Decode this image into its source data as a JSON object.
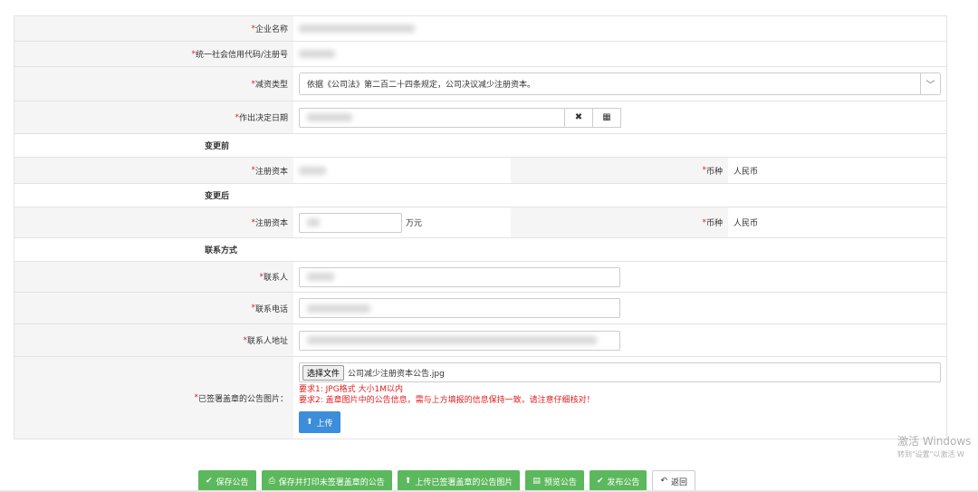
{
  "form": {
    "company_name_label": "企业名称",
    "company_name_value": "",
    "credit_code_label": "统一社会信用代码/注册号",
    "credit_code_value": "",
    "reduction_type_label": "减资类型",
    "reduction_type_value": "依据《公司法》第二百二十四条规定，公司决议减少注册资本。",
    "decision_date_label": "作出决定日期",
    "decision_date_value": "",
    "before_title": "变更前",
    "before_capital_label": "注册资本",
    "before_capital_value": "",
    "before_currency_label": "币种",
    "before_currency_value": "人民币",
    "after_title": "变更后",
    "after_capital_label": "注册资本",
    "after_capital_value": "",
    "after_capital_unit": "万元",
    "after_currency_label": "币种",
    "after_currency_value": "人民币",
    "contact_title": "联系方式",
    "contact_person_label": "联系人",
    "contact_person_value": "",
    "contact_phone_label": "联系电话",
    "contact_phone_value": "",
    "contact_address_label": "联系人地址",
    "contact_address_value": "",
    "notice_image_label": "已签署盖章的公告图片：",
    "file_choose_label": "选择文件",
    "file_name": "公司减少注册资本公告.jpg",
    "requirement1": "要求1: JPG格式 大小1M以内",
    "requirement2": "要求2: 盖章图片中的公告信息，需与上方填报的信息保持一致，请注意仔细核对！",
    "upload_label": "上传",
    "required_mark": "*"
  },
  "actions": {
    "save": "保存公告",
    "save_print": "保存并打印未签署盖章的公告",
    "upload_signed": "上传已签署盖章的公告图片",
    "preview": "预览公告",
    "publish": "发布公告",
    "back": "返回"
  },
  "watermark": {
    "line1": "激活 Windows",
    "line2": "转到\"设置\"以激活 W"
  },
  "colors": {
    "primary_green": "#5cb85c",
    "upload_blue": "#3c8dda",
    "required_red": "#e02020"
  }
}
